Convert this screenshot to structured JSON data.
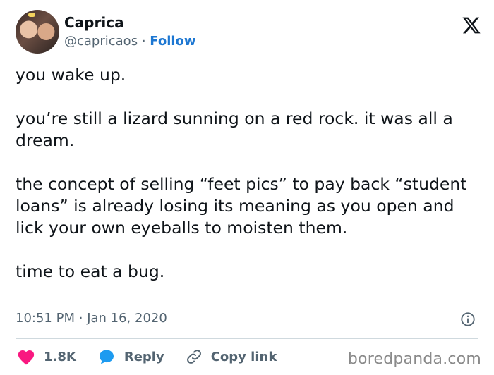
{
  "author": {
    "display_name": "Caprica",
    "handle": "@capricaos",
    "separator": "·",
    "follow_label": "Follow"
  },
  "tweet": {
    "paragraphs": [
      "you wake up.",
      "you’re still a lizard sunning on a red rock. it was all a dream.",
      "the concept of selling “feet pics” to pay back “student loans” is already losing its meaning as you open and lick your own eyeballs to moisten them.",
      "time to eat a bug."
    ],
    "time": "10:51 PM",
    "meta_separator": "·",
    "date": "Jan 16, 2020"
  },
  "actions": {
    "like_count": "1.8K",
    "reply_label": "Reply",
    "copy_label": "Copy link"
  },
  "watermark": "boredpanda.com",
  "colors": {
    "like": "#f91880",
    "reply": "#1d9bf0",
    "follow": "#1d77d2",
    "muted": "#536471",
    "text": "#0f1419"
  },
  "icons": [
    "x-logo-icon",
    "info-icon",
    "heart-icon",
    "reply-bubble-icon",
    "link-icon"
  ]
}
